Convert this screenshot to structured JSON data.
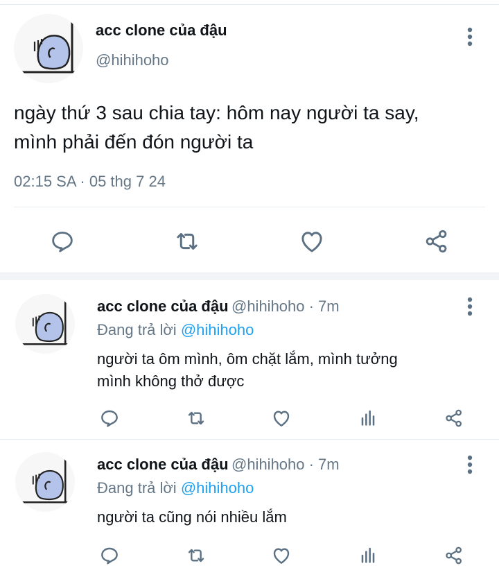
{
  "main_tweet": {
    "display_name": "acc clone của đậu",
    "handle": "@hihihoho",
    "text_line1": "ngày thứ 3 sau chia tay: hôm nay người ta say,",
    "text_line2": "mình phải đến đón người ta",
    "timestamp": "02:15 SA · 05 thg 7 24"
  },
  "replies": [
    {
      "display_name": "acc clone của đậu",
      "handle_time": "@hihihoho · 7m",
      "replying_prefix": "Đang trả lời",
      "replying_to": "@hihihoho",
      "text_line1": "người ta ôm mình, ôm chặt lắm, mình tưởng",
      "text_line2": "mình không thở được"
    },
    {
      "display_name": "acc clone của đậu",
      "handle_time": "@hihihoho · 7m",
      "replying_prefix": "Đang trả lời",
      "replying_to": "@hihihoho",
      "text_line1": "người ta cũng nói nhiều lắm",
      "text_line2": ""
    }
  ],
  "icons": [
    "more-vertical-icon",
    "reply-icon",
    "retweet-icon",
    "like-icon",
    "share-icon",
    "analytics-icon"
  ],
  "colors": {
    "text": "#0f1419",
    "secondary": "#657786",
    "link": "#1da1f2",
    "icon": "#5b7083",
    "avatar_fill": "#b3c3ea"
  }
}
